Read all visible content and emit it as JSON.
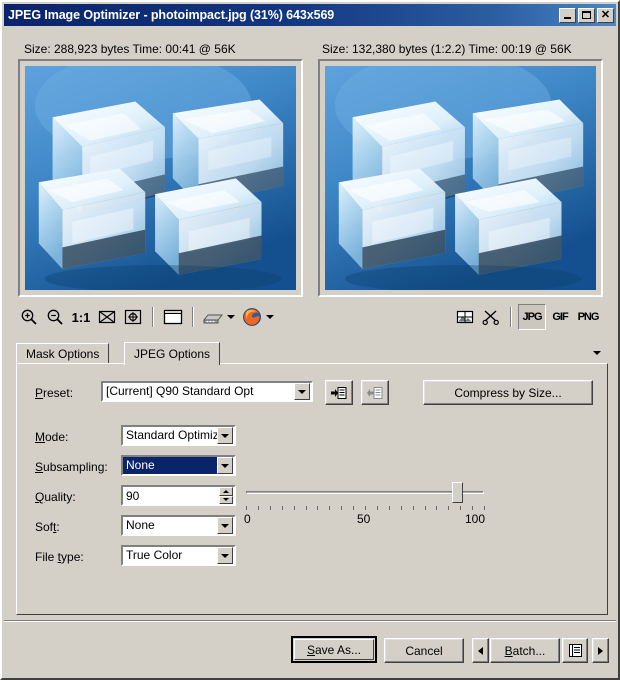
{
  "window": {
    "title": "JPEG Image Optimizer - photoimpact.jpg (31%) 643x569",
    "buttons": {
      "minimize": "_",
      "maximize": "□",
      "close": "✕"
    }
  },
  "previews": {
    "left": {
      "label": "Size: 288,923 bytes Time: 00:41 @ 56K"
    },
    "right": {
      "label": "Size: 132,380 bytes (1:2.2) Time: 00:19 @ 56K"
    }
  },
  "toolbar": {
    "items": [
      {
        "name": "zoom-in-icon",
        "glyph": "zoom-in"
      },
      {
        "name": "zoom-out-icon",
        "glyph": "zoom-out"
      },
      {
        "name": "actual-size-label",
        "glyph": "1:1"
      },
      {
        "name": "fit-window-icon",
        "glyph": "envelope"
      },
      {
        "name": "zoom-to-selection-icon",
        "glyph": "target"
      },
      {
        "name": "single-view-icon",
        "glyph": "window"
      },
      {
        "name": "modem-speed-icon",
        "glyph": "modem"
      },
      {
        "name": "browser-preview-icon",
        "glyph": "firefox"
      }
    ],
    "actual_size": "1:1"
  },
  "formats": {
    "tools": [
      {
        "name": "image-slice-icon",
        "glyph": "slice"
      },
      {
        "name": "scissors-icon",
        "glyph": "scissors"
      }
    ],
    "buttons": [
      {
        "label": "JPG",
        "active": true
      },
      {
        "label": "GIF",
        "active": false
      },
      {
        "label": "PNG",
        "active": false
      }
    ]
  },
  "tabs": [
    {
      "label": "Mask Options",
      "active": false
    },
    {
      "label": "JPEG Options",
      "active": true
    }
  ],
  "preset": {
    "label": "Preset:",
    "value": "[Current] Q90 Standard Opt",
    "add_button": "add-preset",
    "remove_button": "remove-preset",
    "compress_button": "Compress by Size..."
  },
  "options": {
    "mode": {
      "label": "Mode:",
      "value": "Standard Optimized"
    },
    "subsampling": {
      "label": "Subsampling:",
      "value": "None",
      "focused": true
    },
    "quality": {
      "label": "Quality:",
      "value": "90"
    },
    "soft": {
      "label": "Soft:",
      "value": "None"
    },
    "filetype": {
      "label": "File type:",
      "value": "True Color"
    }
  },
  "slider": {
    "min": 0,
    "max": 100,
    "value": 90,
    "tick_labels": [
      "0",
      "50",
      "100"
    ]
  },
  "footer": {
    "save_as": "Save As...",
    "cancel": "Cancel",
    "prev": "prev-arrow",
    "batch": "Batch...",
    "batch_icon": "batch-list-icon",
    "next": "next-arrow"
  },
  "colors": {
    "face": "#d4d0c8",
    "title_start": "#0a246a",
    "title_end": "#4a86c8",
    "highlight": "#0a246a"
  }
}
